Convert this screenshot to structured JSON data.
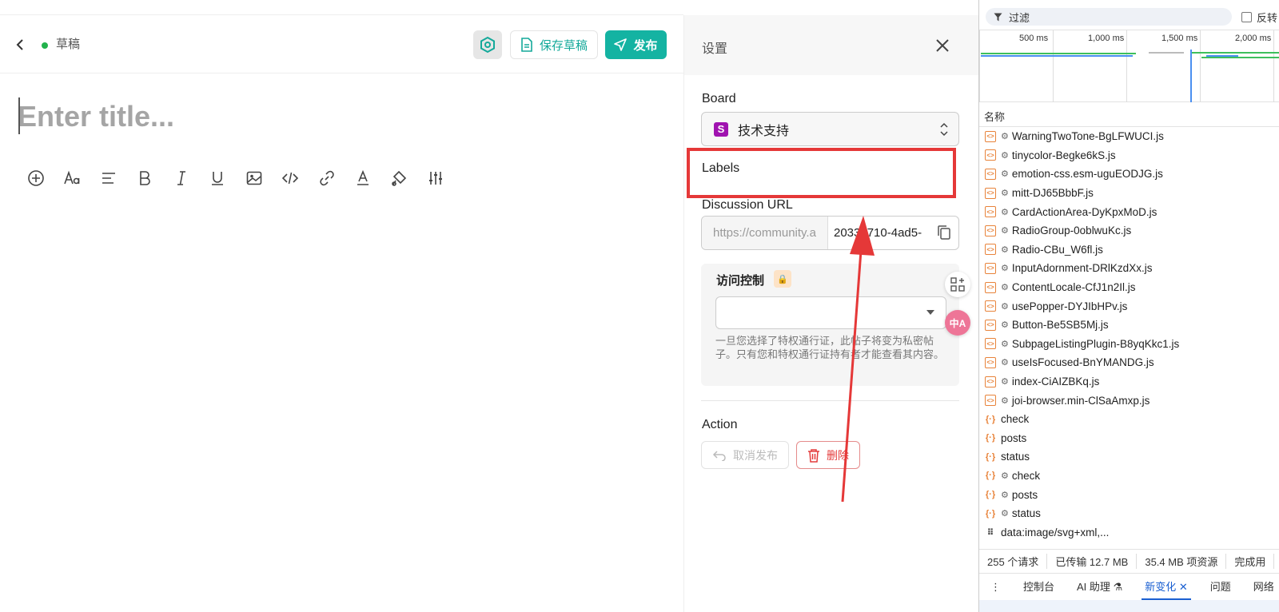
{
  "editor": {
    "status_label": "草稿",
    "save_label": "保存草稿",
    "publish_label": "发布",
    "title_placeholder": "Enter title..."
  },
  "settings": {
    "title": "设置",
    "board_label": "Board",
    "board_badge": "S",
    "board_value": "技术支持",
    "labels_label": "Labels",
    "discussion_url_label": "Discussion URL",
    "url_prefix": "https://community.a",
    "url_suffix": "2033e710-4ad5-",
    "access_title": "访问控制",
    "access_help": "一旦您选择了特权通行证，此帖子将变为私密帖子。只有您和特权通行证持有者才能查看其内容。",
    "action_label": "Action",
    "unpublish_label": "取消发布",
    "delete_label": "删除",
    "translate_label": "中A"
  },
  "devtools": {
    "filter_placeholder": "过滤",
    "invert_label": "反转",
    "timeline_ticks": [
      "500 ms",
      "1,000 ms",
      "1,500 ms",
      "2,000 ms"
    ],
    "name_column": "名称",
    "requests": [
      {
        "name": "WarningTwoTone-BgLFWUCI.js",
        "type": "script",
        "service_worker": true
      },
      {
        "name": "tinycolor-Begke6kS.js",
        "type": "script",
        "service_worker": true
      },
      {
        "name": "emotion-css.esm-uguEODJG.js",
        "type": "script",
        "service_worker": true
      },
      {
        "name": "mitt-DJ65BbbF.js",
        "type": "script",
        "service_worker": true
      },
      {
        "name": "CardActionArea-DyKpxMoD.js",
        "type": "script",
        "service_worker": true
      },
      {
        "name": "RadioGroup-0oblwuKc.js",
        "type": "script",
        "service_worker": true
      },
      {
        "name": "Radio-CBu_W6fl.js",
        "type": "script",
        "service_worker": true
      },
      {
        "name": "InputAdornment-DRlKzdXx.js",
        "type": "script",
        "service_worker": true
      },
      {
        "name": "ContentLocale-CfJ1n2Il.js",
        "type": "script",
        "service_worker": true
      },
      {
        "name": "usePopper-DYJIbHPv.js",
        "type": "script",
        "service_worker": true
      },
      {
        "name": "Button-Be5SB5Mj.js",
        "type": "script",
        "service_worker": true
      },
      {
        "name": "SubpageListingPlugin-B8yqKkc1.js",
        "type": "script",
        "service_worker": true
      },
      {
        "name": "useIsFocused-BnYMANDG.js",
        "type": "script",
        "service_worker": true
      },
      {
        "name": "index-CiAIZBKq.js",
        "type": "script",
        "service_worker": true
      },
      {
        "name": "joi-browser.min-ClSaAmxp.js",
        "type": "script",
        "service_worker": true
      },
      {
        "name": "check",
        "type": "fetch",
        "service_worker": false
      },
      {
        "name": "posts",
        "type": "fetch",
        "service_worker": false
      },
      {
        "name": "status",
        "type": "fetch",
        "service_worker": false
      },
      {
        "name": "check",
        "type": "fetch",
        "service_worker": true
      },
      {
        "name": "posts",
        "type": "fetch",
        "service_worker": true
      },
      {
        "name": "status",
        "type": "fetch",
        "service_worker": true
      },
      {
        "name": "data:image/svg+xml,...",
        "type": "image",
        "service_worker": false
      }
    ],
    "summary": [
      "255 个请求",
      "已传输 12.7 MB",
      "35.4 MB 项资源",
      "完成用"
    ],
    "drawer_tabs": [
      "控制台",
      "AI 助理 ⚗",
      "新变化",
      "问题",
      "网络"
    ],
    "active_drawer_tab": "新变化"
  },
  "colors": {
    "accent": "#14b3a2",
    "danger": "#e43b3b",
    "annotation": "#e53838",
    "board_badge": "#a013b0"
  }
}
